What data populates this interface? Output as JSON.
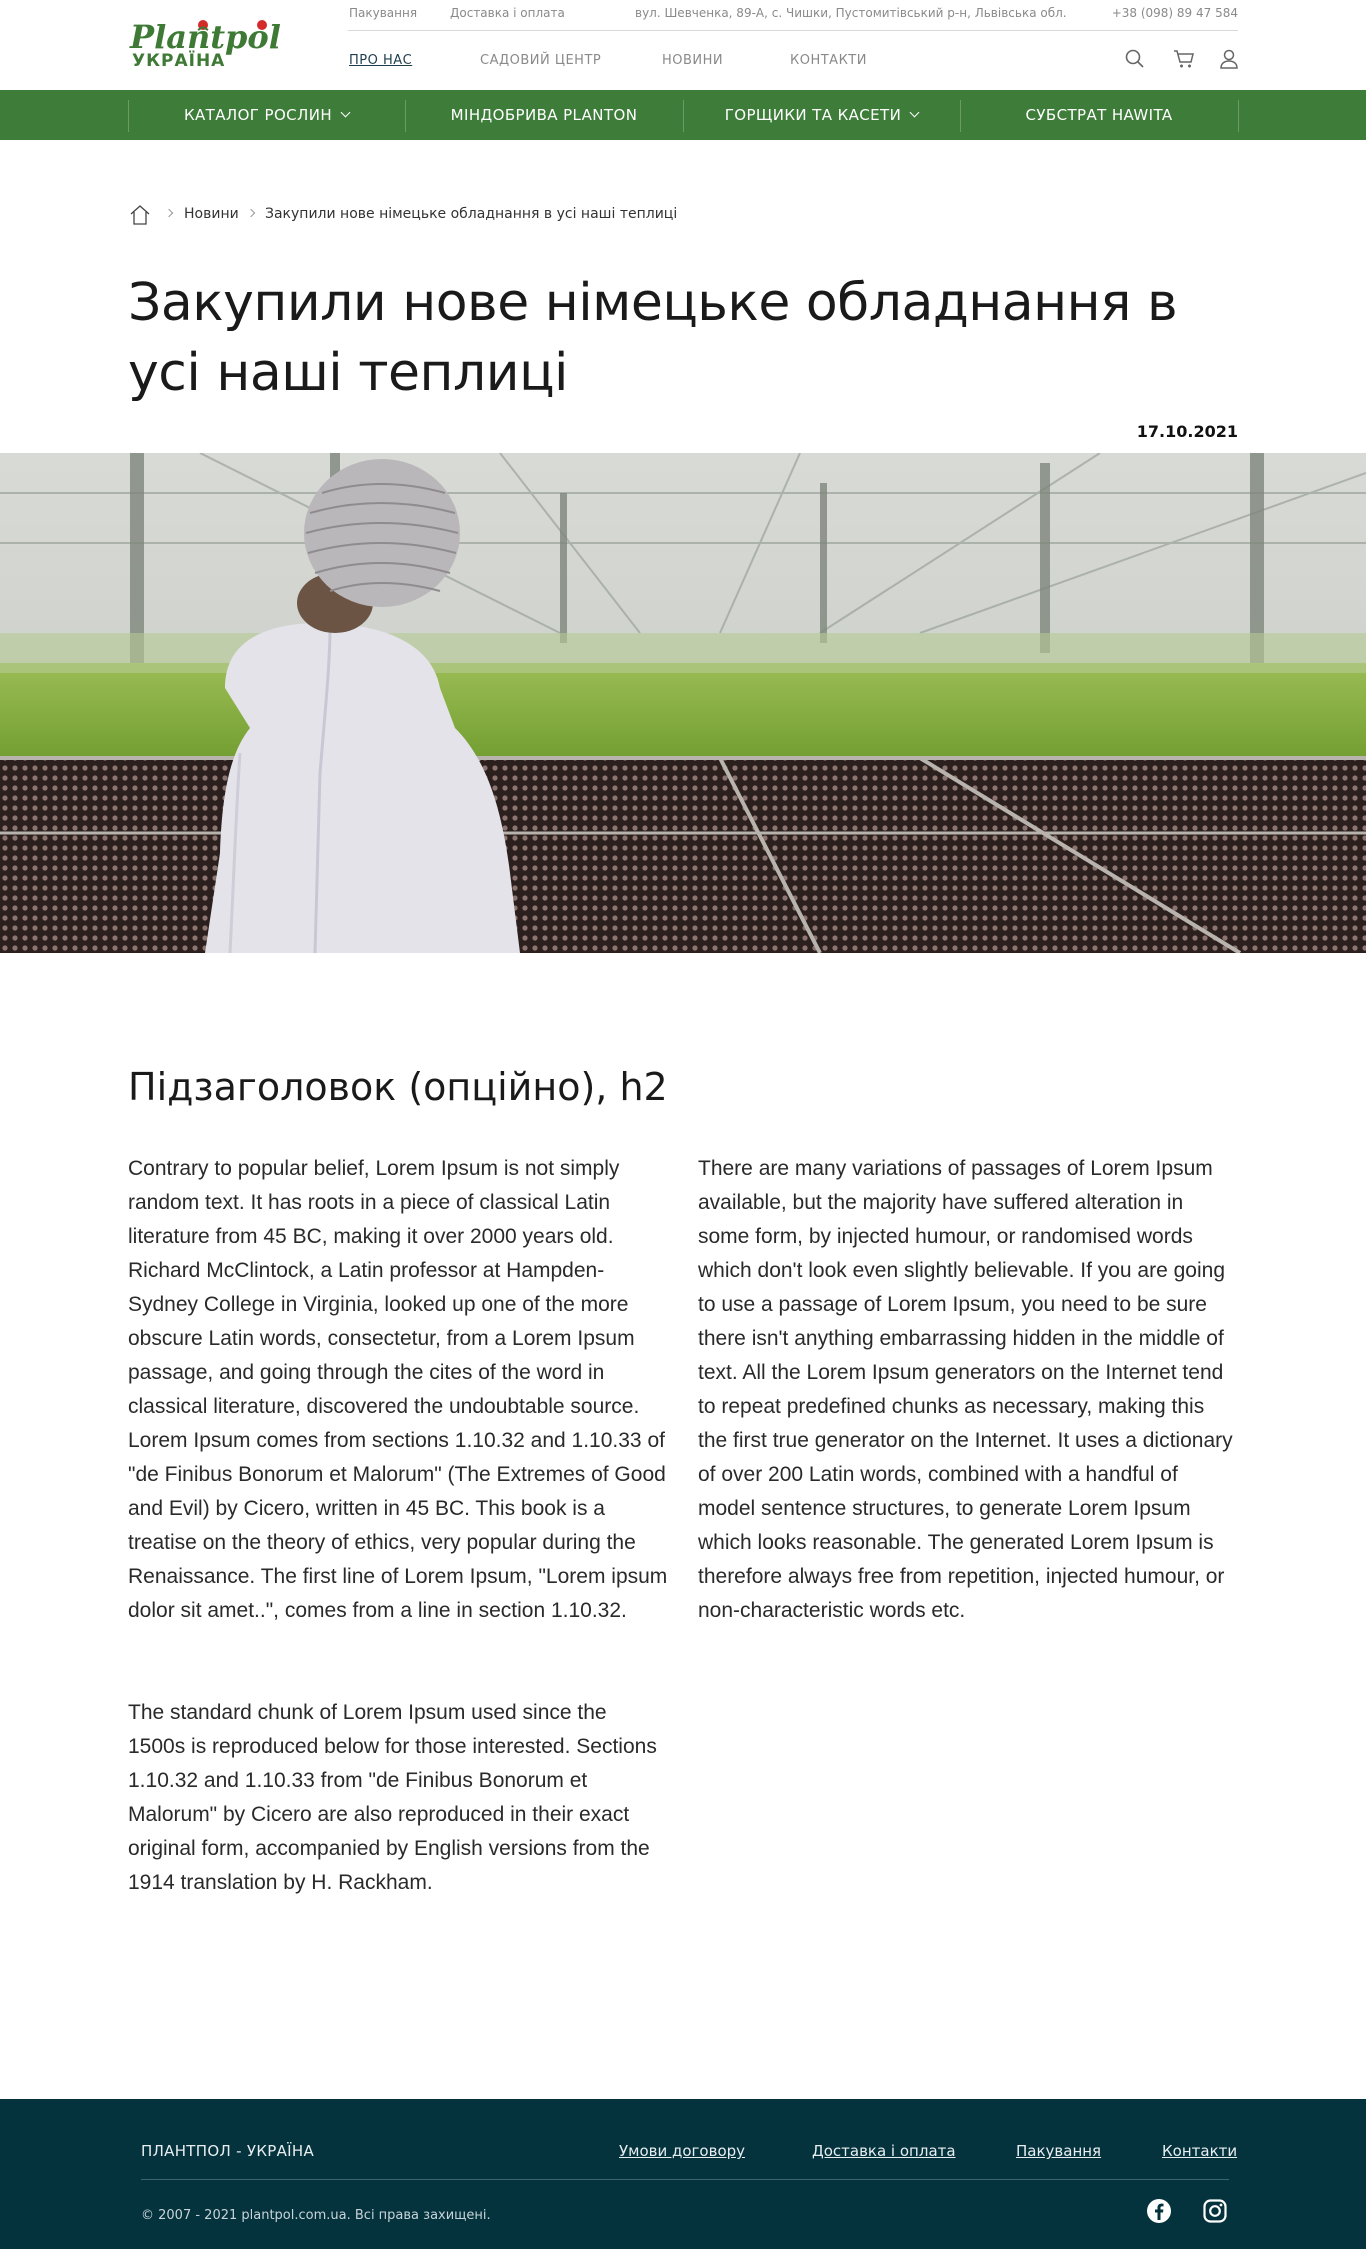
{
  "header": {
    "logo": {
      "brand": "Plantpol",
      "country": "УКРАЇНА"
    },
    "topbar": {
      "packaging": "Пакування",
      "delivery": "Доставка і оплата",
      "address": "вул. Шевченка, 89-А, с. Чишки, Пустомитівський р-н, Львівська обл.",
      "phone": "+38 (098) 89 47 584"
    },
    "nav": [
      {
        "label": "ПРО НАС",
        "active": true
      },
      {
        "label": "САДОВИЙ ЦЕНТР"
      },
      {
        "label": "НОВИНИ"
      },
      {
        "label": "КОНТАКТИ"
      }
    ],
    "icons": [
      "search-icon",
      "cart-icon",
      "user-icon"
    ]
  },
  "catalog_bar": {
    "items": [
      {
        "label": "КАТАЛОГ РОСЛИН",
        "dropdown": true
      },
      {
        "label": "МІНДОБРИВА PLANTON"
      },
      {
        "label": "ГОРЩИКИ ТА КАСЕТИ",
        "dropdown": true
      },
      {
        "label": "СУБСТРАТ HAWITA"
      }
    ],
    "color": "#3d7d39"
  },
  "breadcrumb": {
    "home_icon": "home-icon",
    "items": [
      "Новини",
      "Закупили нове німецьке обладнання в усі наші теплиці"
    ]
  },
  "article": {
    "title": "Закупили нове німецьке обладнання в усі наші теплиці",
    "date": "17.10.2021",
    "subtitle": "Підзаголовок (опційно), h2",
    "paragraphs": [
      "Contrary to popular belief, Lorem Ipsum is not simply random text. It has roots in a piece of classical Latin literature from 45 BC, making it over 2000 years old. Richard McClintock, a Latin professor at Hampden-Sydney College in Virginia, looked up one of the more obscure Latin words, consectetur, from a Lorem Ipsum passage, and going through the cites of the word in classical literature, discovered the undoubtable source. Lorem Ipsum comes from sections 1.10.32 and 1.10.33 of \"de Finibus Bonorum et Malorum\" (The Extremes of Good and Evil) by Cicero, written in 45 BC. This book is a treatise on the theory of ethics, very popular during the Renaissance. The first line of Lorem Ipsum, \"Lorem ipsum dolor sit amet..\", comes from a line in section 1.10.32.",
      "The standard chunk of Lorem Ipsum used since the 1500s is reproduced below for those interested. Sections 1.10.32 and 1.10.33 from \"de Finibus Bonorum et Malorum\" by Cicero are also reproduced in their exact original form, accompanied by English versions from the 1914 translation by H. Rackham.",
      "There are many variations of passages of Lorem Ipsum available, but the majority have suffered alteration in some form, by injected humour, or randomised words which don't look even slightly believable. If you are going to use a passage of Lorem Ipsum, you need to be sure there isn't anything embarrassing hidden in the middle of text. All the Lorem Ipsum generators on the Internet tend to repeat predefined chunks as necessary, making this the first true generator on the Internet. It uses a dictionary of over 200 Latin words, combined with a handful of model sentence structures, to generate Lorem Ipsum which looks reasonable. The generated Lorem Ipsum is therefore always free from repetition, injected humour, or non-characteristic words etc."
    ]
  },
  "footer": {
    "brand": "ПЛАНТПОЛ - УКРАЇНА",
    "links": [
      "Умови договору",
      "Доставка і оплата",
      "Пакування",
      "Контакти"
    ],
    "copyright": "© 2007 - 2021 plantpol.com.ua. Всі права захищені.",
    "social_icons": [
      "facebook-icon",
      "instagram-icon"
    ],
    "color": "#04323d"
  }
}
